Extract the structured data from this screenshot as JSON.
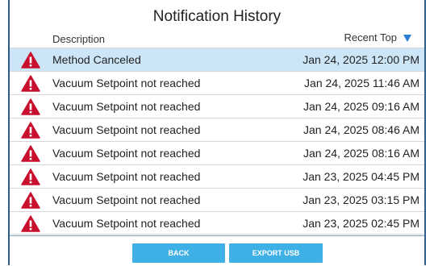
{
  "header": {
    "title": "Notification History"
  },
  "columns": {
    "description": "Description",
    "sort_label": "Recent Top"
  },
  "rows": [
    {
      "description": "Method Canceled",
      "time": "Jan 24, 2025 12:00 PM"
    },
    {
      "description": "Vacuum Setpoint not reached",
      "time": "Jan 24, 2025 11:46 AM"
    },
    {
      "description": "Vacuum Setpoint not reached",
      "time": "Jan 24, 2025 09:16 AM"
    },
    {
      "description": "Vacuum Setpoint not reached",
      "time": "Jan 24, 2025 08:46 AM"
    },
    {
      "description": "Vacuum Setpoint not reached",
      "time": "Jan 24, 2025 08:16 AM"
    },
    {
      "description": "Vacuum Setpoint not reached",
      "time": "Jan 23, 2025 04:45 PM"
    },
    {
      "description": "Vacuum Setpoint not reached",
      "time": "Jan 23, 2025 03:15 PM"
    },
    {
      "description": "Vacuum Setpoint not reached",
      "time": "Jan 23, 2025 02:45 PM"
    }
  ],
  "footer": {
    "back_label": "BACK",
    "export_label": "EXPORT USB"
  },
  "colors": {
    "selected_row": "#cde6f7",
    "warning": "#c8102e",
    "button": "#3fb0e6",
    "sort_arrow": "#2a7fd4"
  }
}
